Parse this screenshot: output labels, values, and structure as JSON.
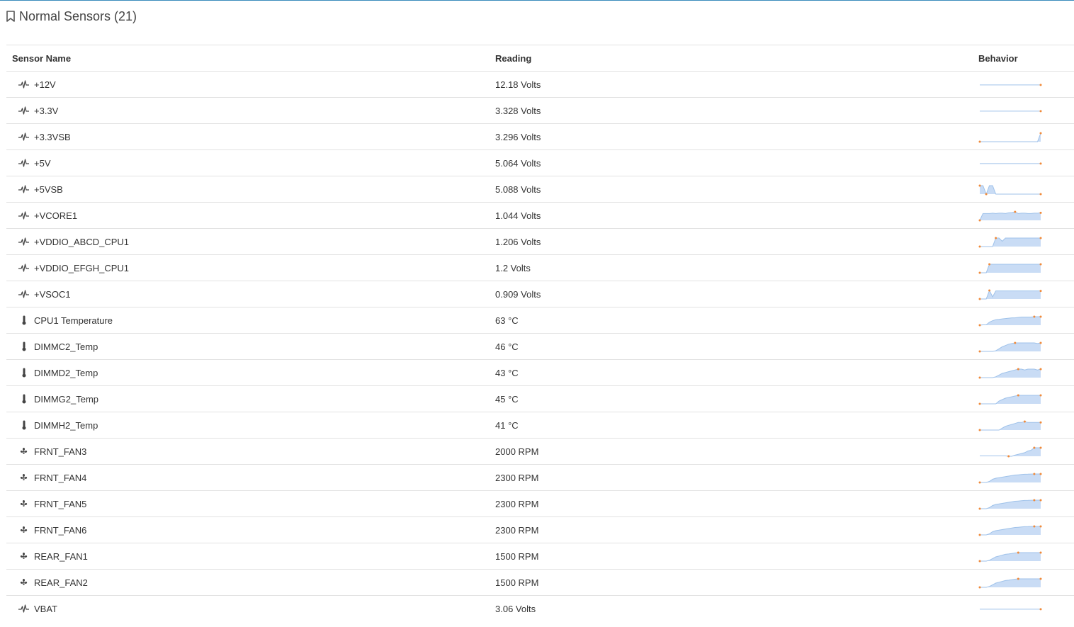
{
  "section": {
    "title": "Normal Sensors (21)",
    "icon": "bookmark-icon"
  },
  "columns": {
    "name": "Sensor Name",
    "reading": "Reading",
    "behavior": "Behavior"
  },
  "colors": {
    "accent": "#3c8dbc",
    "spark_fill": "#c9dcf5",
    "spark_line": "#9fc2ea",
    "spark_dot": "#f08a3a"
  },
  "sensors": [
    {
      "name": "+12V",
      "reading": "12.18 Volts",
      "icon": "pulse-icon",
      "trend": [
        12.18,
        12.18,
        12.18,
        12.18,
        12.18,
        12.18,
        12.18,
        12.18,
        12.18,
        12.18,
        12.18,
        12.18,
        12.18,
        12.18,
        12.18,
        12.18,
        12.18,
        12.18,
        12.18,
        12.18
      ],
      "fill": false
    },
    {
      "name": "+3.3V",
      "reading": "3.328 Volts",
      "icon": "pulse-icon",
      "trend": [
        3.328,
        3.328,
        3.328,
        3.328,
        3.328,
        3.328,
        3.328,
        3.328,
        3.328,
        3.328,
        3.328,
        3.328,
        3.328,
        3.328,
        3.328,
        3.328,
        3.328,
        3.328,
        3.328,
        3.328
      ],
      "fill": false
    },
    {
      "name": "+3.3VSB",
      "reading": "3.296 Volts",
      "icon": "pulse-icon",
      "trend": [
        3.28,
        3.28,
        3.28,
        3.28,
        3.28,
        3.28,
        3.28,
        3.28,
        3.28,
        3.28,
        3.28,
        3.28,
        3.28,
        3.28,
        3.28,
        3.28,
        3.28,
        3.28,
        3.28,
        3.296
      ],
      "fill": true
    },
    {
      "name": "+5V",
      "reading": "5.064 Volts",
      "icon": "pulse-icon",
      "trend": [
        5.064,
        5.064,
        5.064,
        5.064,
        5.064,
        5.064,
        5.064,
        5.064,
        5.064,
        5.064,
        5.064,
        5.064,
        5.064,
        5.064,
        5.064,
        5.064,
        5.064,
        5.064,
        5.064,
        5.064
      ],
      "fill": false
    },
    {
      "name": "+5VSB",
      "reading": "5.088 Volts",
      "icon": "pulse-icon",
      "trend": [
        5.13,
        5.13,
        5.088,
        5.13,
        5.13,
        5.088,
        5.088,
        5.088,
        5.088,
        5.088,
        5.088,
        5.088,
        5.088,
        5.088,
        5.088,
        5.088,
        5.088,
        5.088,
        5.088,
        5.088
      ],
      "fill": true
    },
    {
      "name": "+VCORE1",
      "reading": "1.044 Volts",
      "icon": "pulse-icon",
      "trend": [
        1.0,
        1.04,
        1.04,
        1.04,
        1.042,
        1.04,
        1.042,
        1.042,
        1.04,
        1.044,
        1.046,
        1.05,
        1.04,
        1.042,
        1.042,
        1.04,
        1.04,
        1.042,
        1.042,
        1.044
      ],
      "fill": true
    },
    {
      "name": "+VDDIO_ABCD_CPU1",
      "reading": "1.206 Volts",
      "icon": "pulse-icon",
      "trend": [
        1.19,
        1.19,
        1.19,
        1.19,
        1.19,
        1.206,
        1.206,
        1.2,
        1.206,
        1.206,
        1.206,
        1.206,
        1.206,
        1.206,
        1.206,
        1.206,
        1.206,
        1.206,
        1.206,
        1.206
      ],
      "fill": true
    },
    {
      "name": "+VDDIO_EFGH_CPU1",
      "reading": "1.2 Volts",
      "icon": "pulse-icon",
      "trend": [
        1.18,
        1.18,
        1.18,
        1.2,
        1.2,
        1.2,
        1.2,
        1.2,
        1.2,
        1.2,
        1.2,
        1.2,
        1.2,
        1.2,
        1.2,
        1.2,
        1.2,
        1.2,
        1.2,
        1.2
      ],
      "fill": true
    },
    {
      "name": "+VSOC1",
      "reading": "0.909 Volts",
      "icon": "pulse-icon",
      "trend": [
        0.89,
        0.89,
        0.89,
        0.91,
        0.895,
        0.909,
        0.909,
        0.909,
        0.909,
        0.909,
        0.909,
        0.909,
        0.909,
        0.909,
        0.909,
        0.909,
        0.909,
        0.909,
        0.909,
        0.909
      ],
      "fill": true
    },
    {
      "name": "CPU1 Temperature",
      "reading": "63 °C",
      "icon": "thermometer-icon",
      "trend": [
        40,
        41,
        41,
        48,
        52,
        55,
        56,
        57,
        58,
        59,
        60,
        60,
        61,
        62,
        62,
        62,
        62,
        63,
        63,
        63
      ],
      "fill": true
    },
    {
      "name": "DIMMC2_Temp",
      "reading": "46 °C",
      "icon": "thermometer-icon",
      "trend": [
        33,
        33,
        33,
        33,
        33,
        34,
        37,
        40,
        42,
        44,
        45,
        46,
        46,
        46,
        46,
        46,
        46,
        46,
        45,
        46
      ],
      "fill": true
    },
    {
      "name": "DIMMD2_Temp",
      "reading": "43 °C",
      "icon": "thermometer-icon",
      "trend": [
        33,
        33,
        33,
        33,
        33,
        34,
        36,
        38,
        39,
        40,
        41,
        42,
        43,
        43,
        42,
        43,
        43,
        43,
        42,
        43
      ],
      "fill": true
    },
    {
      "name": "DIMMG2_Temp",
      "reading": "45 °C",
      "icon": "thermometer-icon",
      "trend": [
        33,
        33,
        33,
        33,
        33,
        33,
        37,
        39,
        41,
        42,
        43,
        44,
        45,
        45,
        45,
        45,
        45,
        45,
        45,
        45
      ],
      "fill": true
    },
    {
      "name": "DIMMH2_Temp",
      "reading": "41 °C",
      "icon": "thermometer-icon",
      "trend": [
        33,
        33,
        33,
        33,
        33,
        33,
        33,
        35,
        37,
        38,
        39,
        40,
        41,
        41,
        42,
        41,
        41,
        41,
        41,
        41
      ],
      "fill": true
    },
    {
      "name": "FRNT_FAN3",
      "reading": "2000 RPM",
      "icon": "fan-icon",
      "trend": [
        1500,
        1500,
        1500,
        1500,
        1500,
        1500,
        1500,
        1500,
        1500,
        1480,
        1480,
        1550,
        1600,
        1650,
        1700,
        1800,
        1850,
        2000,
        2000,
        2000
      ],
      "fill": true
    },
    {
      "name": "FRNT_FAN4",
      "reading": "2300 RPM",
      "icon": "fan-icon",
      "trend": [
        1500,
        1500,
        1500,
        1600,
        1800,
        1900,
        1950,
        2000,
        2050,
        2100,
        2150,
        2200,
        2220,
        2250,
        2270,
        2280,
        2290,
        2300,
        2300,
        2300
      ],
      "fill": true
    },
    {
      "name": "FRNT_FAN5",
      "reading": "2300 RPM",
      "icon": "fan-icon",
      "trend": [
        1500,
        1500,
        1500,
        1600,
        1800,
        1900,
        1950,
        2000,
        2050,
        2100,
        2150,
        2200,
        2220,
        2250,
        2270,
        2280,
        2290,
        2300,
        2300,
        2300
      ],
      "fill": true
    },
    {
      "name": "FRNT_FAN6",
      "reading": "2300 RPM",
      "icon": "fan-icon",
      "trend": [
        1500,
        1500,
        1500,
        1600,
        1800,
        1900,
        1950,
        2000,
        2050,
        2100,
        2150,
        2200,
        2220,
        2250,
        2270,
        2280,
        2290,
        2300,
        2300,
        2300
      ],
      "fill": true
    },
    {
      "name": "REAR_FAN1",
      "reading": "1500 RPM",
      "icon": "fan-icon",
      "trend": [
        1000,
        1000,
        1000,
        1050,
        1150,
        1250,
        1300,
        1350,
        1400,
        1420,
        1450,
        1480,
        1500,
        1500,
        1500,
        1500,
        1500,
        1500,
        1500,
        1500
      ],
      "fill": true
    },
    {
      "name": "REAR_FAN2",
      "reading": "1500 RPM",
      "icon": "fan-icon",
      "trend": [
        1000,
        1000,
        1000,
        1050,
        1150,
        1250,
        1300,
        1350,
        1400,
        1420,
        1450,
        1480,
        1500,
        1500,
        1500,
        1500,
        1500,
        1500,
        1500,
        1500
      ],
      "fill": true
    },
    {
      "name": "VBAT",
      "reading": "3.06 Volts",
      "icon": "pulse-icon",
      "trend": [
        3.06,
        3.06,
        3.06,
        3.06,
        3.06,
        3.06,
        3.06,
        3.06,
        3.06,
        3.06,
        3.06,
        3.06,
        3.06,
        3.06,
        3.06,
        3.06,
        3.06,
        3.06,
        3.06,
        3.06
      ],
      "fill": false
    }
  ]
}
